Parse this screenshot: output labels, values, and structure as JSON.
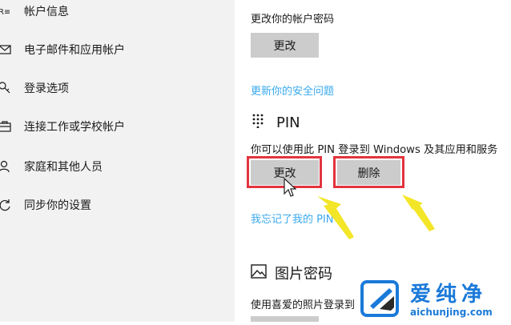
{
  "sidebar": {
    "items": [
      {
        "label": "帐户信息",
        "icon": "account-info-icon"
      },
      {
        "label": "电子邮件和应用帐户",
        "icon": "mail-icon"
      },
      {
        "label": "登录选项",
        "icon": "key-icon"
      },
      {
        "label": "连接工作或学校帐户",
        "icon": "briefcase-icon"
      },
      {
        "label": "家庭和其他人员",
        "icon": "person-icon"
      },
      {
        "label": "同步你的设置",
        "icon": "sync-icon"
      }
    ]
  },
  "password": {
    "desc": "更改你的帐户密码",
    "change_label": "更改",
    "security_link": "更新你的安全问题"
  },
  "pin": {
    "title": "PIN",
    "desc": "你可以使用此 PIN 登录到 Windows 及其应用和服务",
    "change_label": "更改",
    "remove_label": "删除",
    "forgot_link": "我忘记了我的 PIN"
  },
  "picture_password": {
    "title": "图片密码",
    "desc": "使用喜爱的照片登录到"
  },
  "watermark": {
    "text": "爱纯净",
    "url": "aichunjing.com"
  },
  "colors": {
    "accent_link": "#3aa9ee",
    "highlight": "#e2343e",
    "arrow": "#f3e628",
    "button": "#cccccc"
  }
}
